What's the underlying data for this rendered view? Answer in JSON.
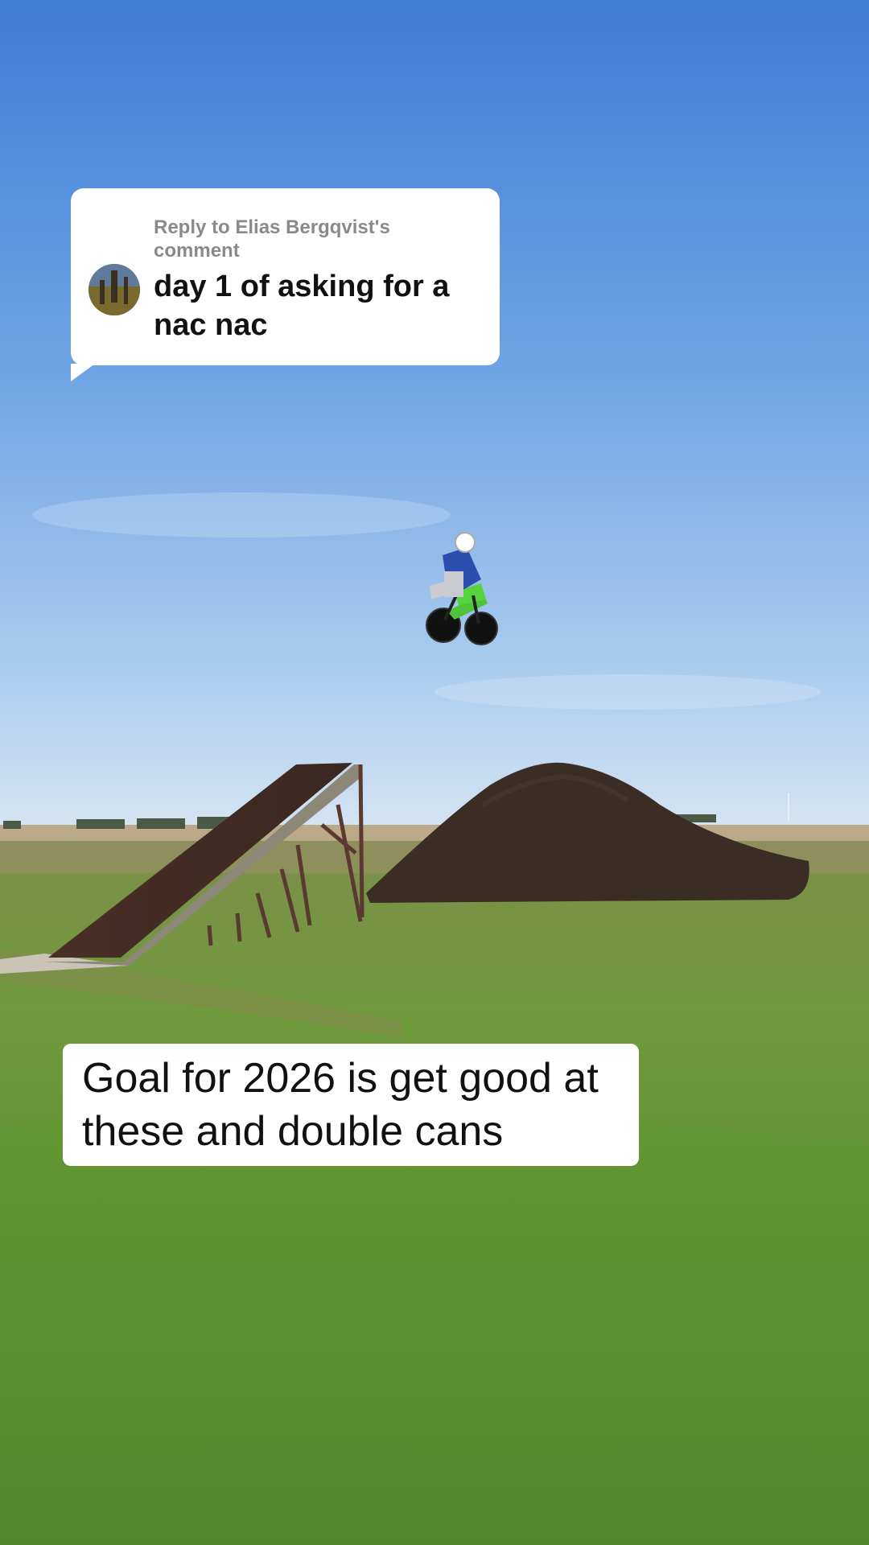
{
  "reply_sticker": {
    "header": "Reply to Elias Bergqvist's comment",
    "comment": "day 1 of asking for a nac nac"
  },
  "caption": {
    "text": "Goal for 2026 is get good at these and double cans"
  }
}
